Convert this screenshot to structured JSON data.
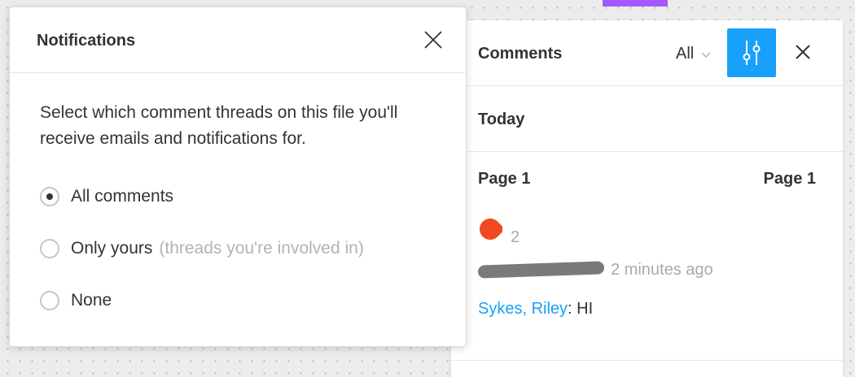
{
  "colors": {
    "accent_blue": "#18a0fb",
    "accent_purple": "#a259ff",
    "pin_red": "#f24822",
    "muted_text": "#aaaaaa"
  },
  "notifications": {
    "title": "Notifications",
    "description": "Select which comment threads on this file you'll receive emails and notifications for.",
    "options": [
      {
        "label": "All comments",
        "hint": "",
        "selected": true
      },
      {
        "label": "Only yours",
        "hint": "(threads you're involved in)",
        "selected": false
      },
      {
        "label": "None",
        "hint": "",
        "selected": false
      }
    ],
    "close_icon": "close-icon"
  },
  "comments": {
    "title": "Comments",
    "filter_label": "All",
    "filter_icon": "chevron-down-icon",
    "settings_icon": "sliders-icon",
    "close_icon": "close-icon",
    "section_heading": "Today",
    "threads": [
      {
        "page_left": "Page 1",
        "page_right": "Page 1",
        "pin_icon": "comment-pin-icon",
        "reply_count": "2",
        "time_ago": "2 minutes ago",
        "author": "Sykes, Riley",
        "separator": ": ",
        "message": "HI"
      }
    ]
  }
}
